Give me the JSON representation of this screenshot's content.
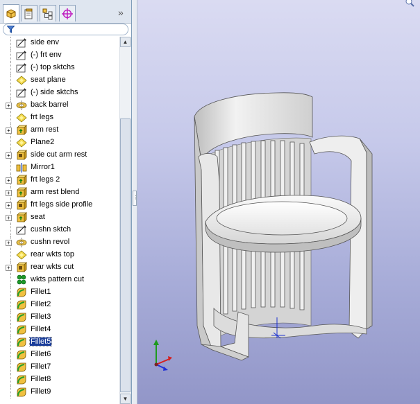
{
  "tree": {
    "items": [
      {
        "label": "side env",
        "icon": "sketch-icon",
        "expander": false
      },
      {
        "label": "(-) frt env",
        "icon": "sketch-icon",
        "expander": false
      },
      {
        "label": "(-) top sktchs",
        "icon": "sketch-icon",
        "expander": false
      },
      {
        "label": "seat plane",
        "icon": "plane-icon",
        "expander": false
      },
      {
        "label": "(-) side sktchs",
        "icon": "sketch-icon",
        "expander": false
      },
      {
        "label": "back barrel",
        "icon": "revolve-icon",
        "expander": true
      },
      {
        "label": "frt legs",
        "icon": "plane-icon",
        "expander": false
      },
      {
        "label": "arm rest",
        "icon": "extrude-boss-icon",
        "expander": true
      },
      {
        "label": "Plane2",
        "icon": "plane-icon",
        "expander": false
      },
      {
        "label": "side cut arm rest",
        "icon": "extrude-cut-icon",
        "expander": true
      },
      {
        "label": "Mirror1",
        "icon": "mirror-icon",
        "expander": false
      },
      {
        "label": "frt legs 2",
        "icon": "extrude-boss-icon",
        "expander": true
      },
      {
        "label": "arm rest blend",
        "icon": "extrude-boss-icon",
        "expander": true
      },
      {
        "label": "frt legs side profile",
        "icon": "extrude-cut-icon",
        "expander": true
      },
      {
        "label": "seat",
        "icon": "extrude-boss-icon",
        "expander": true
      },
      {
        "label": "cushn sktch",
        "icon": "sketch-icon",
        "expander": false
      },
      {
        "label": "cushn revol",
        "icon": "revolve-icon",
        "expander": true
      },
      {
        "label": "rear wkts top",
        "icon": "plane-icon",
        "expander": false
      },
      {
        "label": "rear wkts cut",
        "icon": "extrude-cut-icon",
        "expander": true
      },
      {
        "label": "wkts pattern cut",
        "icon": "pattern-icon",
        "expander": false
      },
      {
        "label": "Fillet1",
        "icon": "fillet-icon",
        "expander": false
      },
      {
        "label": "Fillet2",
        "icon": "fillet-icon",
        "expander": false
      },
      {
        "label": "Fillet3",
        "icon": "fillet-icon",
        "expander": false
      },
      {
        "label": "Fillet4",
        "icon": "fillet-icon",
        "expander": false
      },
      {
        "label": "Fillet5",
        "icon": "fillet-icon",
        "expander": false,
        "selected": true
      },
      {
        "label": "Fillet6",
        "icon": "fillet-icon",
        "expander": false
      },
      {
        "label": "Fillet7",
        "icon": "fillet-icon",
        "expander": false
      },
      {
        "label": "Fillet8",
        "icon": "fillet-icon",
        "expander": false
      },
      {
        "label": "Fillet9",
        "icon": "fillet-icon",
        "expander": false
      }
    ]
  },
  "tabs": [
    "feature-manager-tab",
    "property-manager-tab",
    "configuration-manager-tab",
    "dimxpert-manager-tab"
  ],
  "colors": {
    "selection": "#1a3d9a",
    "viewport_top": "#dadbf2",
    "viewport_bottom": "#9296c8",
    "model": "#e6e6e6"
  }
}
